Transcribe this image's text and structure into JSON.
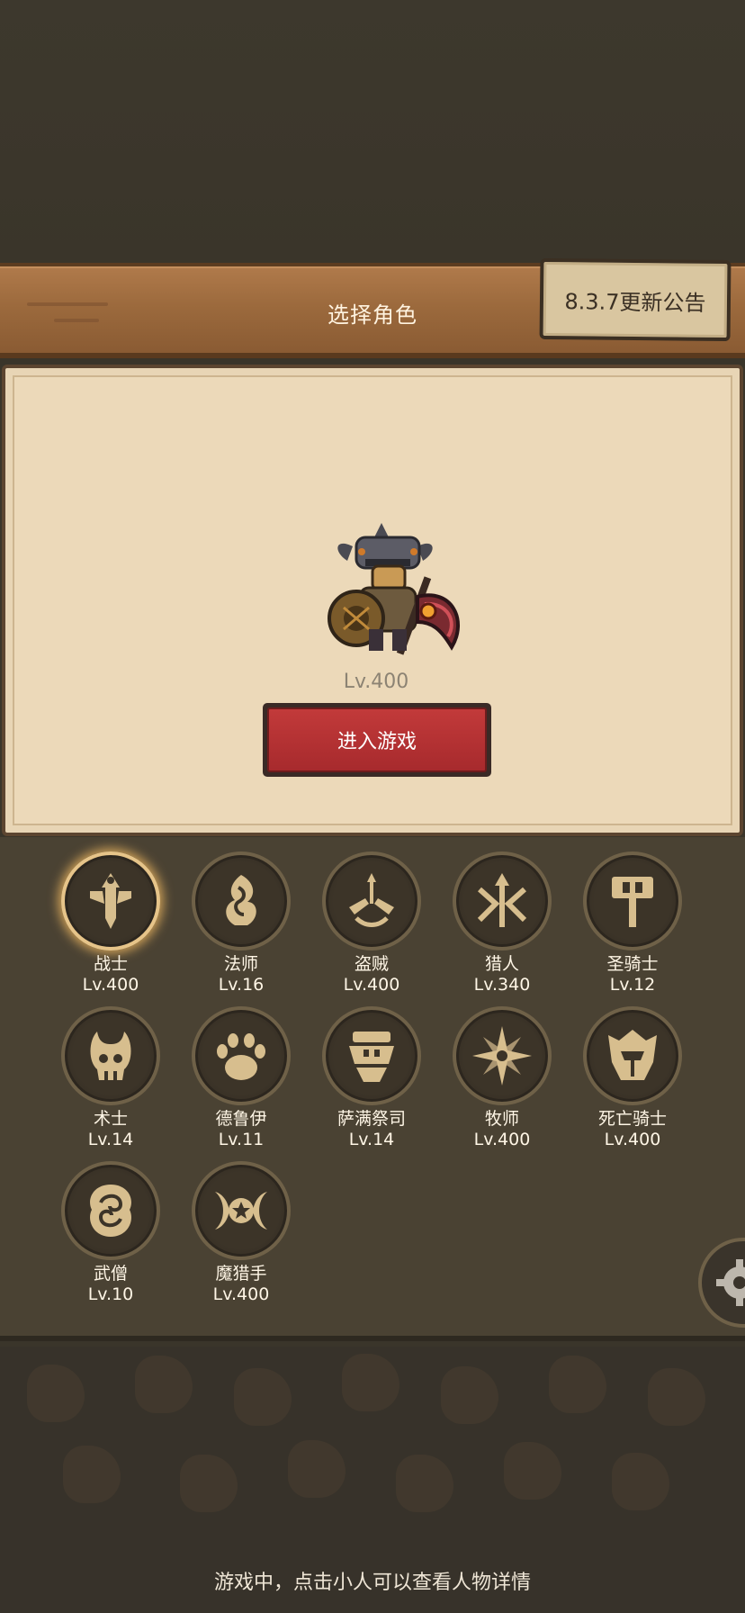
{
  "header": {
    "title": "选择角色",
    "notice_button": "8.3.7更新公告"
  },
  "selected_character": {
    "level": "Lv.400",
    "enter_button": "进入游戏"
  },
  "classes": [
    {
      "name": "战士",
      "level": "Lv.400",
      "icon": "warrior-sword-icon",
      "selected": true
    },
    {
      "name": "法师",
      "level": "Lv.16",
      "icon": "mage-flame-icon",
      "selected": false
    },
    {
      "name": "盗贼",
      "level": "Lv.400",
      "icon": "rogue-daggers-icon",
      "selected": false
    },
    {
      "name": "猎人",
      "level": "Lv.340",
      "icon": "hunter-arrows-icon",
      "selected": false
    },
    {
      "name": "圣骑士",
      "level": "Lv.12",
      "icon": "paladin-hammer-icon",
      "selected": false
    },
    {
      "name": "术士",
      "level": "Lv.14",
      "icon": "warlock-skull-icon",
      "selected": false
    },
    {
      "name": "德鲁伊",
      "level": "Lv.11",
      "icon": "druid-paw-icon",
      "selected": false
    },
    {
      "name": "萨满祭司",
      "level": "Lv.14",
      "icon": "shaman-totem-icon",
      "selected": false
    },
    {
      "name": "牧师",
      "level": "Lv.400",
      "icon": "priest-star-icon",
      "selected": false
    },
    {
      "name": "死亡骑士",
      "level": "Lv.400",
      "icon": "death-knight-helm-icon",
      "selected": false
    },
    {
      "name": "武僧",
      "level": "Lv.10",
      "icon": "monk-swirl-icon",
      "selected": false
    },
    {
      "name": "魔猎手",
      "level": "Lv.400",
      "icon": "demon-hunter-emblem-icon",
      "selected": false
    }
  ],
  "footer": {
    "hint": "游戏中，点击小人可以查看人物详情"
  },
  "colors": {
    "accent_red": "#b8312f",
    "emblem_gold": "#d7be8e",
    "selected_glow": "#e6c489"
  }
}
